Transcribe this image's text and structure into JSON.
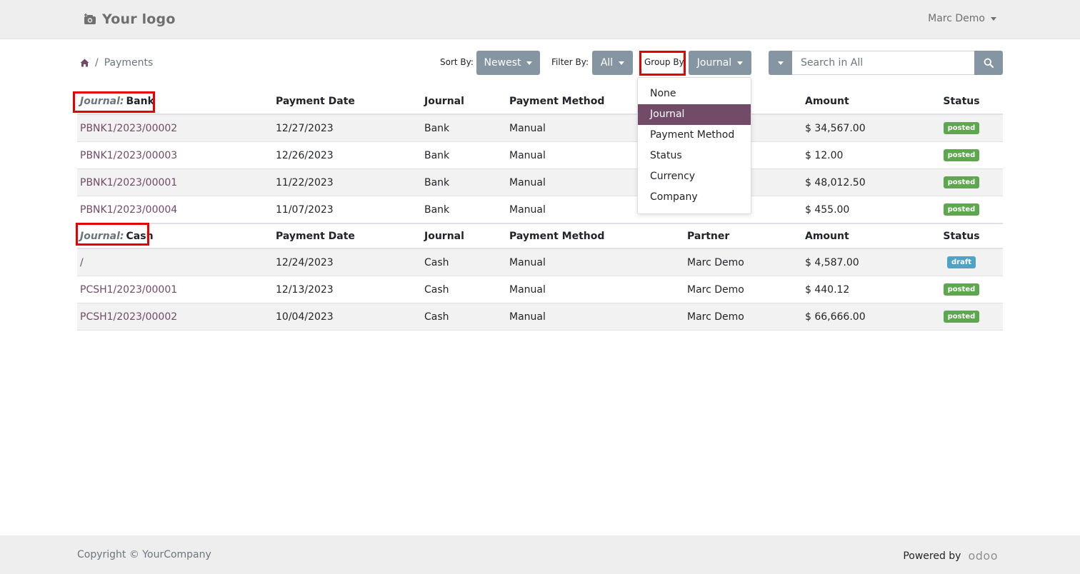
{
  "header": {
    "logo_text": "Your logo",
    "user_name": "Marc Demo"
  },
  "breadcrumb": {
    "current": "Payments"
  },
  "toolbar": {
    "sort_label": "Sort By:",
    "sort_value": "Newest",
    "filter_label": "Filter By:",
    "filter_value": "All",
    "group_label": "Group By:",
    "group_value": "Journal"
  },
  "search": {
    "placeholder": "Search in All"
  },
  "group_by_menu": {
    "items": [
      "None",
      "Journal",
      "Payment Method",
      "Status",
      "Currency",
      "Company"
    ],
    "selected": "Journal"
  },
  "columns": {
    "payment_date": "Payment Date",
    "journal": "Journal",
    "payment_method": "Payment Method",
    "partner": "Partner",
    "amount": "Amount",
    "status": "Status"
  },
  "groups": [
    {
      "label": "Journal:",
      "value": "Bank",
      "rows": [
        {
          "name": "PBNK1/2023/00002",
          "date": "12/27/2023",
          "journal": "Bank",
          "method": "Manual",
          "partner": "",
          "amount": "$ 34,567.00",
          "status": "posted"
        },
        {
          "name": "PBNK1/2023/00003",
          "date": "12/26/2023",
          "journal": "Bank",
          "method": "Manual",
          "partner": "",
          "amount": "$ 12.00",
          "status": "posted"
        },
        {
          "name": "PBNK1/2023/00001",
          "date": "11/22/2023",
          "journal": "Bank",
          "method": "Manual",
          "partner": "",
          "amount": "$ 48,012.50",
          "status": "posted"
        },
        {
          "name": "PBNK1/2023/00004",
          "date": "11/07/2023",
          "journal": "Bank",
          "method": "Manual",
          "partner": "",
          "amount": "$ 455.00",
          "status": "posted"
        }
      ]
    },
    {
      "label": "Journal:",
      "value": "Cash",
      "rows": [
        {
          "name": "/",
          "date": "12/24/2023",
          "journal": "Cash",
          "method": "Manual",
          "partner": "Marc Demo",
          "amount": "$ 4,587.00",
          "status": "draft"
        },
        {
          "name": "PCSH1/2023/00001",
          "date": "12/13/2023",
          "journal": "Cash",
          "method": "Manual",
          "partner": "Marc Demo",
          "amount": "$ 440.12",
          "status": "posted"
        },
        {
          "name": "PCSH1/2023/00002",
          "date": "10/04/2023",
          "journal": "Cash",
          "method": "Manual",
          "partner": "Marc Demo",
          "amount": "$ 66,666.00",
          "status": "posted"
        }
      ]
    }
  ],
  "footer": {
    "copyright": "Copyright © YourCompany",
    "powered_by": "Powered by",
    "brand": "odoo"
  },
  "colors": {
    "accent": "#714B67",
    "button_grey": "#8595a2",
    "posted": "#5fa74e",
    "draft": "#4fa3c4",
    "highlight": "#e60000"
  }
}
